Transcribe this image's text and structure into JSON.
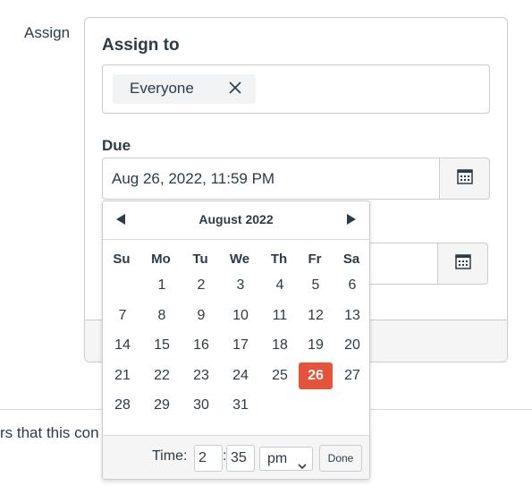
{
  "assign": {
    "label": "Assign"
  },
  "assign_to": {
    "title": "Assign to",
    "tags": [
      {
        "label": "Everyone"
      }
    ]
  },
  "due": {
    "label": "Due",
    "value": "Aug 26, 2022, 11:59 PM"
  },
  "calendar": {
    "month_title": "August 2022",
    "weekdays": [
      "Su",
      "Mo",
      "Tu",
      "We",
      "Th",
      "Fr",
      "Sa"
    ],
    "first_weekday_index": 1,
    "days_in_month": 31,
    "selected_day": 26,
    "selected_color": "#e5543a",
    "time": {
      "label": "Time:",
      "hour": "2",
      "minute": "35",
      "period": "pm",
      "done_label": "Done"
    }
  },
  "help_text": "rs that this con"
}
